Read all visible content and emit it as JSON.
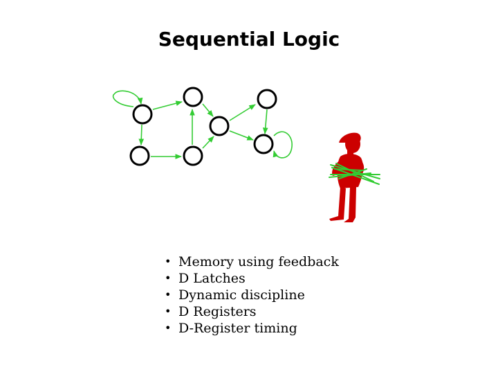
{
  "slide": {
    "title": "Sequential Logic",
    "bullets": [
      "Memory using feedback",
      "D Latches",
      "Dynamic discipline",
      "D Registers",
      "D-Register timing"
    ]
  },
  "colors": {
    "edge": "#33cc33",
    "node_stroke": "#000000",
    "figure": "#cc0000"
  }
}
